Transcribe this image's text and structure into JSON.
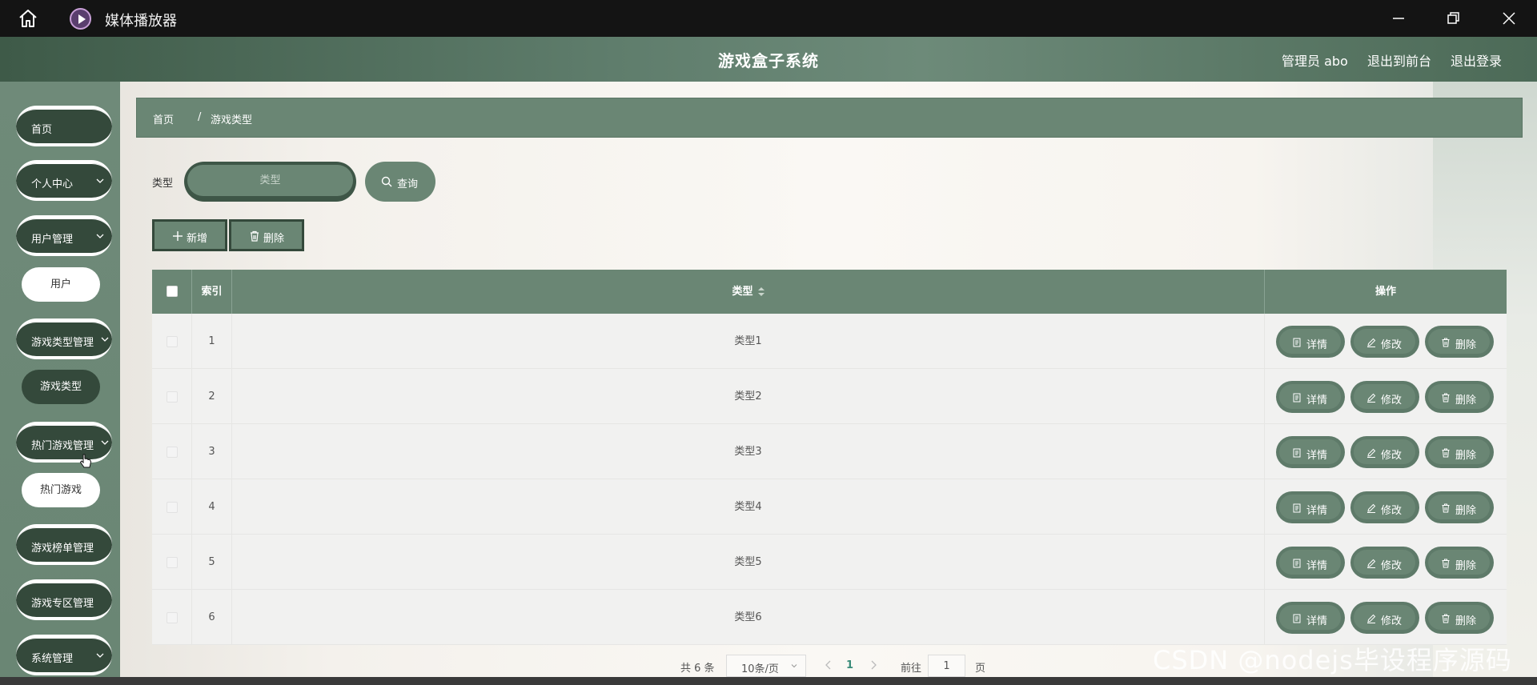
{
  "window": {
    "title": "媒体播放器",
    "controls": [
      "minimize-icon",
      "restore-icon",
      "close-icon"
    ]
  },
  "header": {
    "title": "游戏盒子系统",
    "admin": "管理员 abo",
    "front": "退出到前台",
    "logout": "退出登录"
  },
  "sidebar": {
    "items": [
      {
        "label": "首页"
      },
      {
        "label": "个人中心"
      },
      {
        "label": "用户管理"
      },
      {
        "label": "用户"
      },
      {
        "label": "游戏类型管理"
      },
      {
        "label": "游戏类型"
      },
      {
        "label": "热门游戏管理"
      },
      {
        "label": "热门游戏"
      },
      {
        "label": "游戏榜单管理"
      },
      {
        "label": "游戏专区管理"
      },
      {
        "label": "系统管理"
      }
    ]
  },
  "breadcrumb": {
    "home": "首页",
    "sep": "/",
    "current": "游戏类型"
  },
  "search": {
    "label": "类型",
    "placeholder": "类型",
    "button": "查询"
  },
  "toolbar": {
    "add": "新增",
    "delete": "删除"
  },
  "table": {
    "headers": {
      "index": "索引",
      "type": "类型",
      "ops": "操作"
    },
    "rows": [
      {
        "index": "1",
        "type": "类型1"
      },
      {
        "index": "2",
        "type": "类型2"
      },
      {
        "index": "3",
        "type": "类型3"
      },
      {
        "index": "4",
        "type": "类型4"
      },
      {
        "index": "5",
        "type": "类型5"
      },
      {
        "index": "6",
        "type": "类型6"
      }
    ],
    "ops": {
      "detail": "详情",
      "edit": "修改",
      "delete": "删除"
    }
  },
  "pager": {
    "total": "共 6 条",
    "page_size": "10条/页",
    "current": "1",
    "goto": "前往",
    "goto_value": "1",
    "unit": "页"
  },
  "watermark": "CSDN @nodejs毕设程序源码",
  "colors": {
    "accent": "#6a8674",
    "dark": "#34493b",
    "titlebar": "#141414"
  }
}
